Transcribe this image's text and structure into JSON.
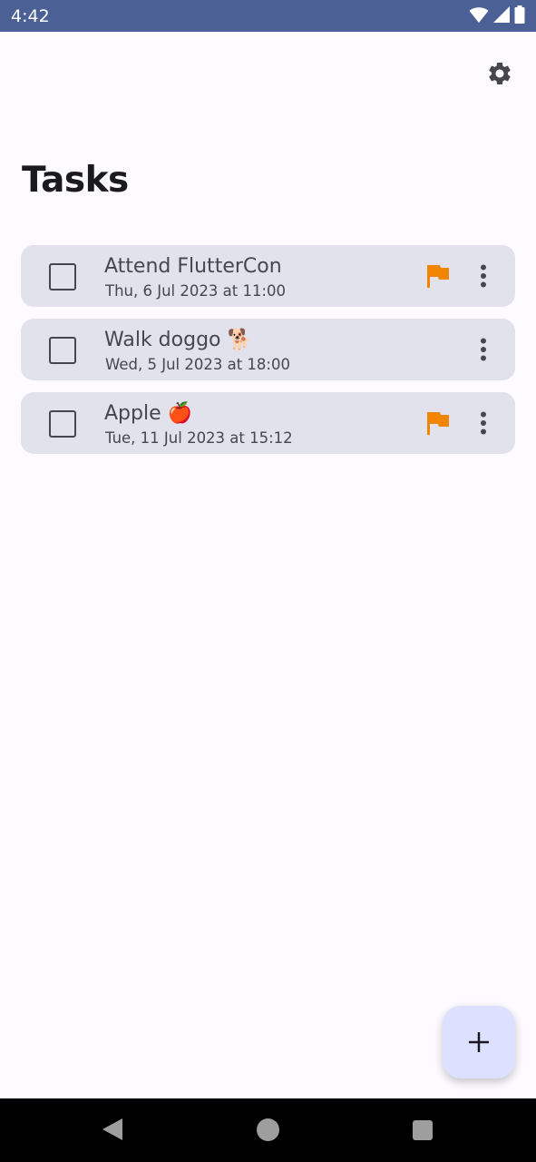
{
  "status_bar": {
    "time": "4:42",
    "icons": [
      "wifi-icon",
      "cellular-signal-icon",
      "battery-icon"
    ],
    "color": "#4b6196"
  },
  "app_bar": {
    "settings_icon": "gear-icon"
  },
  "page": {
    "title": "Tasks"
  },
  "tasks": [
    {
      "title": "Attend FlutterCon",
      "date": "Thu, 6 Jul 2023 at 11:00",
      "checked": false,
      "flagged": true
    },
    {
      "title": "Walk doggo 🐕",
      "date": "Wed, 5 Jul 2023 at 18:00",
      "checked": false,
      "flagged": false
    },
    {
      "title": "Apple 🍎",
      "date": "Tue, 11 Jul 2023 at 15:12",
      "checked": false,
      "flagged": true
    }
  ],
  "colors": {
    "flag": "#f28500",
    "card": "#e2e2ec",
    "fab": "#dce1ff",
    "accent_text": "#46464f"
  },
  "fab": {
    "icon": "plus-icon"
  },
  "nav_bar": {
    "icons": [
      "back-icon",
      "home-icon",
      "recents-icon"
    ]
  }
}
